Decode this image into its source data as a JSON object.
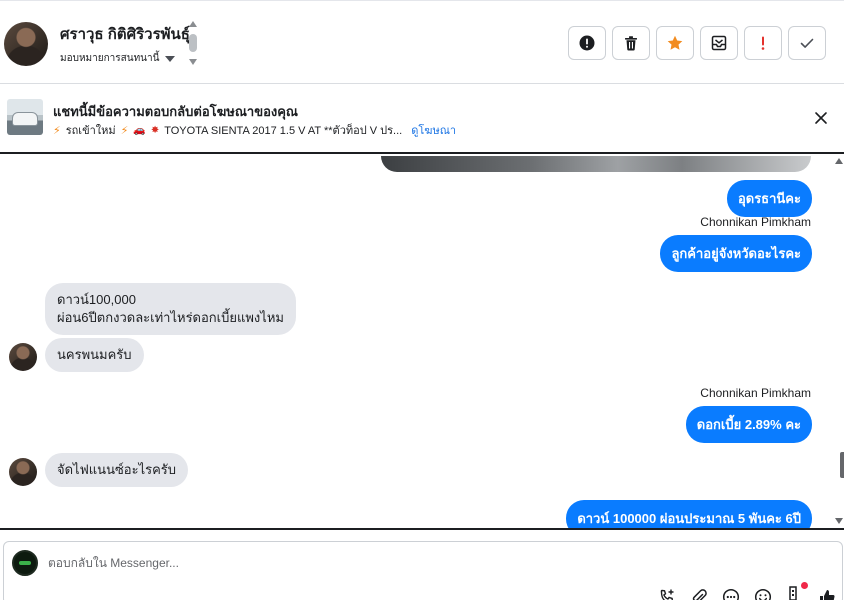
{
  "header": {
    "contact_name": "ศราวุธ กิติศิริวรพันธุ์",
    "assign_label": "มอบหมายการสนทนานี้"
  },
  "actions": [
    {
      "name": "report-spam-button",
      "icon": "exclamation-circle-icon"
    },
    {
      "name": "delete-button",
      "icon": "trash-icon"
    },
    {
      "name": "star-button",
      "icon": "star-icon",
      "color": "#f28b1e"
    },
    {
      "name": "mark-unread-button",
      "icon": "envelope-icon"
    },
    {
      "name": "follow-up-button",
      "icon": "exclamation-icon",
      "color": "#e4312c"
    },
    {
      "name": "done-button",
      "icon": "checkmark-icon"
    }
  ],
  "banner": {
    "title": "แชทนี้มีข้อความตอบกลับต่อโฆษณาของคุณ",
    "tag": "รถเข้าใหม่",
    "ad_text": "TOYOTA SIENTA 2017 1.5 V AT **ตัวท็อป V ปร...",
    "link": "ดูโฆษณา"
  },
  "messages": {
    "out_1": "อุดรธานีคะ",
    "sender_1": "Chonnikan Pimkham",
    "out_2": "ลูกค้าอยู่จังหวัดอะไรคะ",
    "in_1_line1": "ดาวน์100,000",
    "in_1_line2": "ผ่อน6ปีตกงวดละเท่าไหร่ดอกเบี้ยแพงไหม",
    "in_2": "นครพนมครับ",
    "sender_2": "Chonnikan Pimkham",
    "out_3": "ดอกเบี้ย 2.89% คะ",
    "in_3": "จัดไฟแนนซ์อะไรครับ",
    "out_4": "ดาวน์ 100000 ผ่อนประมาณ 5 พันคะ 6ปี"
  },
  "composer": {
    "placeholder": "ตอบกลับใน Messenger..."
  },
  "colors": {
    "outgoing_bubble": "#0a7cff",
    "incoming_bubble": "#e4e6eb",
    "link": "#1b74e4"
  }
}
